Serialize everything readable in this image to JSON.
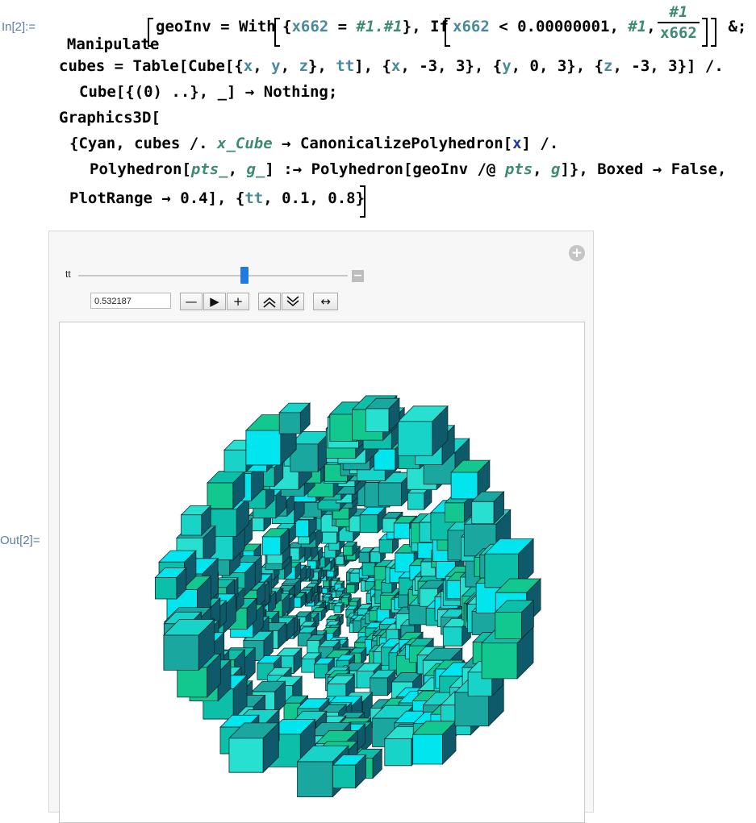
{
  "cell": {
    "in_label": "In[2]:=",
    "out_label": "Out[2]=",
    "line1": {
      "manipulate": "Manipulate",
      "geoinv": "geoInv",
      "eq": " = ",
      "with": "With",
      "open": "{",
      "x662": "x662",
      "eq2": " = ",
      "slot_expr": "#1.#1",
      "close": "}, ",
      "if": "If",
      "x662b": "x662",
      "lt": " < 0.00000001, ",
      "slot": "#1",
      "comma": ",",
      "frac_num": "#1",
      "frac_den": "x662",
      "tail": " &;"
    },
    "line2": {
      "a": "cubes = Table[Cube[{",
      "x": "x",
      "c1": ", ",
      "y": "y",
      "c2": ", ",
      "z": "z",
      "c3": "}, ",
      "tt": "tt",
      "c4": "], {",
      "x2": "x",
      "c5": ", -3, 3}, {",
      "y2": "y",
      "c6": ", 0, 3}, {",
      "z2": "z",
      "c7": ", -3, 3}] /."
    },
    "line3": "Cube[{(0) ..}, _] → Nothing;",
    "line4": "Graphics3D[",
    "line5": {
      "a": "{Cyan, cubes /. ",
      "xcube": "x_Cube",
      "b": " → CanonicalizePolyhedron[",
      "x": "x",
      "c": "] /."
    },
    "line6": {
      "a": "Polyhedron[",
      "pts": "pts_",
      "b": ", ",
      "g": "g_",
      "c": "] :→ Polyhedron[geoInv /@ ",
      "pts2": "pts",
      "d": ", ",
      "g2": "g",
      "e": "]}, Boxed → False,"
    },
    "line7": {
      "a": "PlotRange → 0.4], {",
      "tt": "tt",
      "b": ", 0.1, 0.8}"
    }
  },
  "manipulate": {
    "var_label": "tt",
    "value": "0.532187",
    "buttons": {
      "minus": "—",
      "play": "▶",
      "plus": "+",
      "faster": "≈",
      "slower": "≈",
      "direction": "↔"
    },
    "expand_icon": "plus-circle-icon",
    "slider_fraction": 0.617
  },
  "colors": {
    "cyan": "#00e5ee",
    "teal": "#1aa7a0",
    "green": "#12c88e",
    "dark": "#0f5a6a",
    "label": "#5a7fa6"
  }
}
